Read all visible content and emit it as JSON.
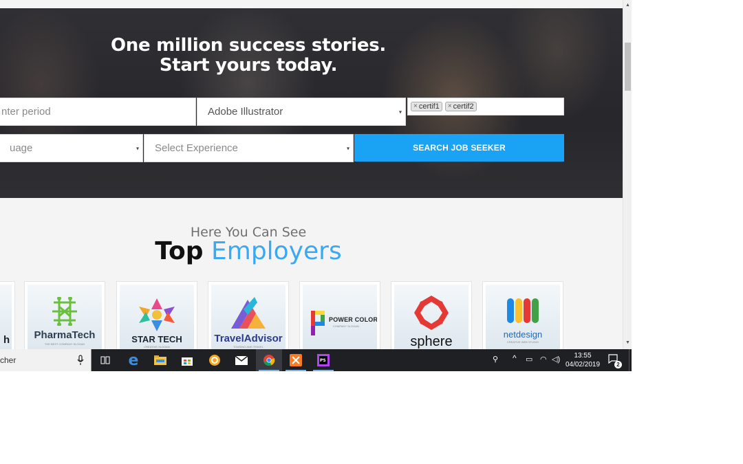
{
  "hero": {
    "title_line1": "One million success stories.",
    "title_line2": "Start yours today."
  },
  "search_form": {
    "period_placeholder": "nter period",
    "skill_selected": "Adobe Illustrator",
    "certif_tags": [
      "certif1",
      "certif2"
    ],
    "tag_remove_symbol": "×",
    "language_placeholder": "uage",
    "experience_placeholder": "Select Experience",
    "search_button_label": "SEARCH JOB SEEKER",
    "caret": "▾"
  },
  "employers": {
    "subtitle": "Here You Can See",
    "title_bold": "Top",
    "title_colored": "Employers",
    "cards": [
      {
        "name": "h"
      },
      {
        "name": "PharmaTech",
        "slogan": "THE BEST COMPANY SLOGAN"
      },
      {
        "name": "STAR TECH",
        "slogan": "CREATIVE SLOGAN"
      },
      {
        "name": "TravelAdvisor",
        "slogan": "TOURING AND TRAVEL"
      },
      {
        "name": "POWER COLOR",
        "slogan": "COMPANY SLOGAN"
      },
      {
        "name": "sphere"
      },
      {
        "name": "netdesign",
        "slogan": "CREATIVE WEB STUDIO"
      }
    ]
  },
  "taskbar": {
    "search_text": "cher",
    "time": "13:55",
    "date": "04/02/2019",
    "notification_count": "2",
    "apps": [
      "task-view",
      "edge",
      "file-explorer",
      "store",
      "app-orange",
      "mail",
      "chrome",
      "xampp",
      "phpstorm"
    ]
  },
  "colors": {
    "accent": "#1aa3f5",
    "title_blue": "#3aa9f1",
    "taskbar": "#1f2024"
  }
}
